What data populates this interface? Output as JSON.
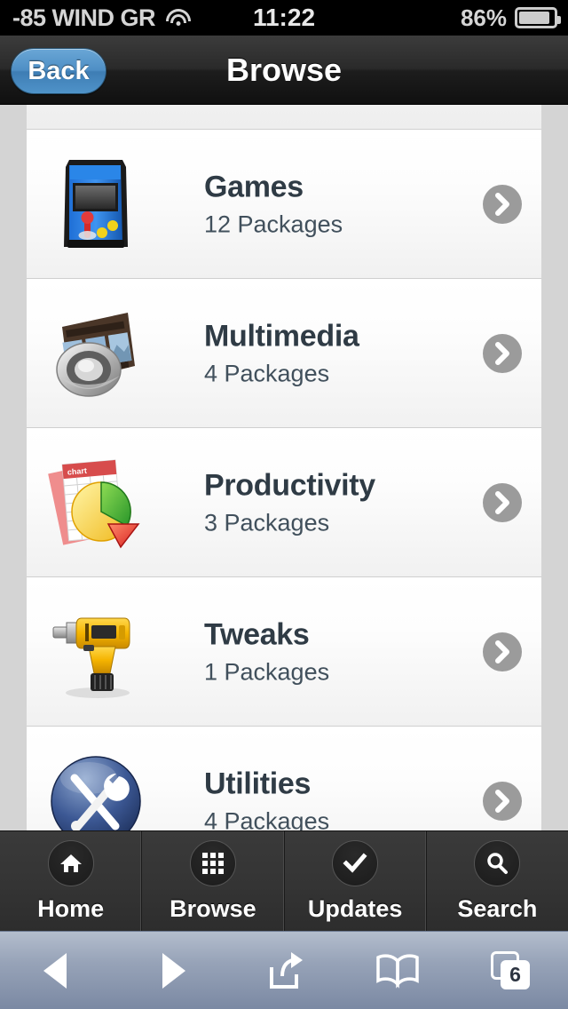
{
  "status_bar": {
    "carrier": "-85 WIND GR",
    "wifi_icon": "wifi-icon",
    "time": "11:22",
    "battery_percent": "86%",
    "battery_level": 86,
    "battery_icon": "battery-icon"
  },
  "nav_bar": {
    "back_label": "Back",
    "title": "Browse"
  },
  "list": {
    "partial_row_top": true,
    "rows": [
      {
        "icon": "arcade-cabinet-icon",
        "title": "Games",
        "subtitle": "12 Packages",
        "chevron": "chevron-right-icon"
      },
      {
        "icon": "film-speaker-icon",
        "title": "Multimedia",
        "subtitle": "4 Packages",
        "chevron": "chevron-right-icon"
      },
      {
        "icon": "chart-spreadsheet-icon",
        "title": "Productivity",
        "subtitle": "3 Packages",
        "chevron": "chevron-right-icon"
      },
      {
        "icon": "power-drill-icon",
        "title": "Tweaks",
        "subtitle": "1 Packages",
        "chevron": "chevron-right-icon"
      },
      {
        "icon": "tools-sphere-icon",
        "title": "Utilities",
        "subtitle": "4 Packages",
        "chevron": "chevron-right-icon"
      }
    ]
  },
  "tab_bar": {
    "tabs": [
      {
        "label": "Home",
        "icon": "home-icon"
      },
      {
        "label": "Browse",
        "icon": "grid-icon"
      },
      {
        "label": "Updates",
        "icon": "checkmark-icon"
      },
      {
        "label": "Search",
        "icon": "search-icon"
      }
    ],
    "selected": "Browse"
  },
  "safari_toolbar": {
    "back_icon": "back-arrow-icon",
    "forward_icon": "forward-arrow-icon",
    "share_icon": "share-icon",
    "bookmarks_icon": "bookmarks-icon",
    "tabs_icon": "tabs-icon",
    "tab_count": "6"
  },
  "colors": {
    "status_bar_bg": "#000000",
    "nav_bar_bg": "#2a2a2a",
    "back_button_blue": "#4e8fc5",
    "list_bg": "#ffffff",
    "page_bg": "#d4d4d4",
    "title_text": "#2f3b45",
    "chevron_gray": "#9b9b9b",
    "tab_bar_bg": "#343434",
    "safari_bar_bg": "#97a3b8"
  }
}
